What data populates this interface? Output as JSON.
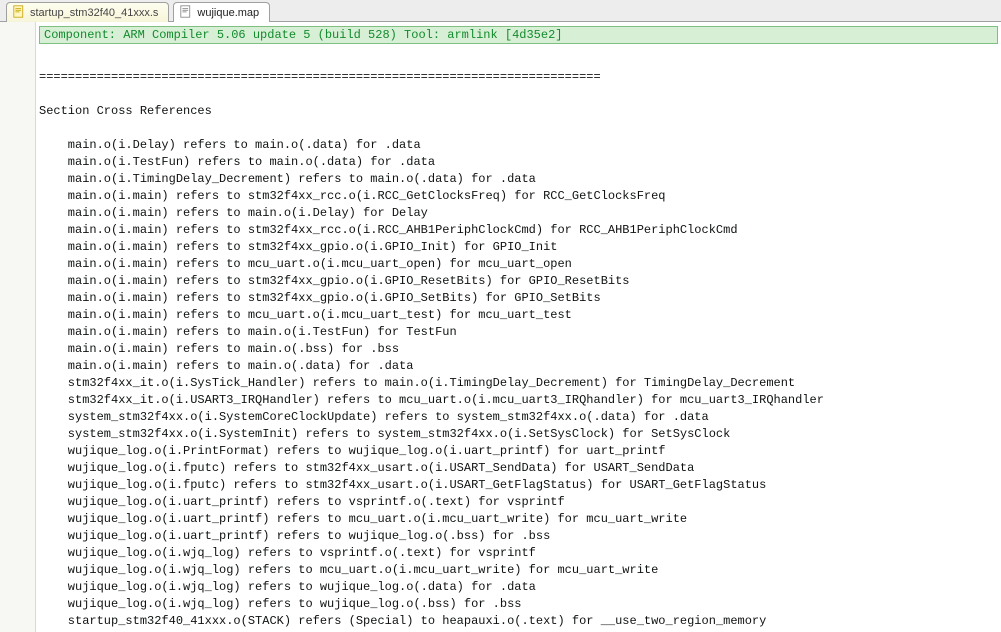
{
  "tabs": [
    {
      "label": "startup_stm32f40_41xxx.s",
      "active": false
    },
    {
      "label": "wujique.map",
      "active": true
    }
  ],
  "header_line": "Component: ARM Compiler 5.06 update 5 (build 528) Tool: armlink [4d35e2]",
  "separator": "==============================================================================",
  "section_title": "Section Cross References",
  "cross_refs": [
    "main.o(i.Delay) refers to main.o(.data) for .data",
    "main.o(i.TestFun) refers to main.o(.data) for .data",
    "main.o(i.TimingDelay_Decrement) refers to main.o(.data) for .data",
    "main.o(i.main) refers to stm32f4xx_rcc.o(i.RCC_GetClocksFreq) for RCC_GetClocksFreq",
    "main.o(i.main) refers to main.o(i.Delay) for Delay",
    "main.o(i.main) refers to stm32f4xx_rcc.o(i.RCC_AHB1PeriphClockCmd) for RCC_AHB1PeriphClockCmd",
    "main.o(i.main) refers to stm32f4xx_gpio.o(i.GPIO_Init) for GPIO_Init",
    "main.o(i.main) refers to mcu_uart.o(i.mcu_uart_open) for mcu_uart_open",
    "main.o(i.main) refers to stm32f4xx_gpio.o(i.GPIO_ResetBits) for GPIO_ResetBits",
    "main.o(i.main) refers to stm32f4xx_gpio.o(i.GPIO_SetBits) for GPIO_SetBits",
    "main.o(i.main) refers to mcu_uart.o(i.mcu_uart_test) for mcu_uart_test",
    "main.o(i.main) refers to main.o(i.TestFun) for TestFun",
    "main.o(i.main) refers to main.o(.bss) for .bss",
    "main.o(i.main) refers to main.o(.data) for .data",
    "stm32f4xx_it.o(i.SysTick_Handler) refers to main.o(i.TimingDelay_Decrement) for TimingDelay_Decrement",
    "stm32f4xx_it.o(i.USART3_IRQHandler) refers to mcu_uart.o(i.mcu_uart3_IRQhandler) for mcu_uart3_IRQhandler",
    "system_stm32f4xx.o(i.SystemCoreClockUpdate) refers to system_stm32f4xx.o(.data) for .data",
    "system_stm32f4xx.o(i.SystemInit) refers to system_stm32f4xx.o(i.SetSysClock) for SetSysClock",
    "wujique_log.o(i.PrintFormat) refers to wujique_log.o(i.uart_printf) for uart_printf",
    "wujique_log.o(i.fputc) refers to stm32f4xx_usart.o(i.USART_SendData) for USART_SendData",
    "wujique_log.o(i.fputc) refers to stm32f4xx_usart.o(i.USART_GetFlagStatus) for USART_GetFlagStatus",
    "wujique_log.o(i.uart_printf) refers to vsprintf.o(.text) for vsprintf",
    "wujique_log.o(i.uart_printf) refers to mcu_uart.o(i.mcu_uart_write) for mcu_uart_write",
    "wujique_log.o(i.uart_printf) refers to wujique_log.o(.bss) for .bss",
    "wujique_log.o(i.wjq_log) refers to vsprintf.o(.text) for vsprintf",
    "wujique_log.o(i.wjq_log) refers to mcu_uart.o(i.mcu_uart_write) for mcu_uart_write",
    "wujique_log.o(i.wjq_log) refers to wujique_log.o(.data) for .data",
    "wujique_log.o(i.wjq_log) refers to wujique_log.o(.bss) for .bss",
    "startup_stm32f40_41xxx.o(STACK) refers (Special) to heapauxi.o(.text) for __use_two_region_memory"
  ],
  "indent_ref": "    ",
  "editor_colors": {
    "header_bg": "#d7f0d5",
    "header_border": "#7fbf7f",
    "text": "#0f1212",
    "comment_green": "#138a2e"
  }
}
